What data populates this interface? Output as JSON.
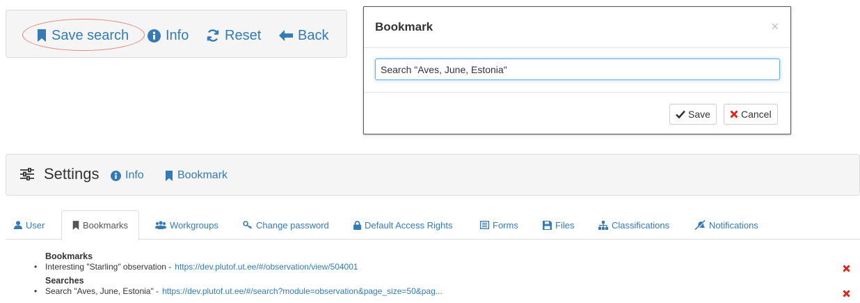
{
  "toolbar": {
    "save_search_label": "Save search",
    "info_label": "Info",
    "reset_label": "Reset",
    "back_label": "Back"
  },
  "modal": {
    "title": "Bookmark",
    "close_symbol": "×",
    "input_value": "Search \"Aves, June, Estonia\"",
    "save_label": "Save",
    "cancel_label": "Cancel"
  },
  "settings": {
    "title": "Settings",
    "info_label": "Info",
    "bookmark_label": "Bookmark"
  },
  "tabs": [
    {
      "label": "User",
      "icon": "user-icon"
    },
    {
      "label": "Bookmarks",
      "icon": "bookmark-icon",
      "active": true
    },
    {
      "label": "Workgroups",
      "icon": "users-icon"
    },
    {
      "label": "Change password",
      "icon": "key-icon"
    },
    {
      "label": "Default Access Rights",
      "icon": "lock-icon"
    },
    {
      "label": "Forms",
      "icon": "list-alt-icon"
    },
    {
      "label": "Files",
      "icon": "floppy-icon"
    },
    {
      "label": "Classifications",
      "icon": "tree-icon"
    },
    {
      "label": "Notifications",
      "icon": "bell-off-icon"
    }
  ],
  "bookmarks": {
    "heading": "Bookmarks",
    "items": [
      {
        "bullet": "•",
        "name": "Interesting \"Starling\" observation -",
        "url": "https://dev.plutof.ut.ee/#/observation/view/504001"
      }
    ]
  },
  "searches": {
    "heading": "Searches",
    "items": [
      {
        "bullet": "•",
        "name": "Search \"Aves, June, Estonia\" -",
        "url": "https://dev.plutof.ut.ee/#/search?module=observation&page_size=50&pag..."
      }
    ]
  },
  "colors": {
    "link": "#337ab7",
    "panel_bg": "#f5f5f5",
    "delete_red": "#d9261c",
    "highlight_ellipse": "#e8837a"
  }
}
